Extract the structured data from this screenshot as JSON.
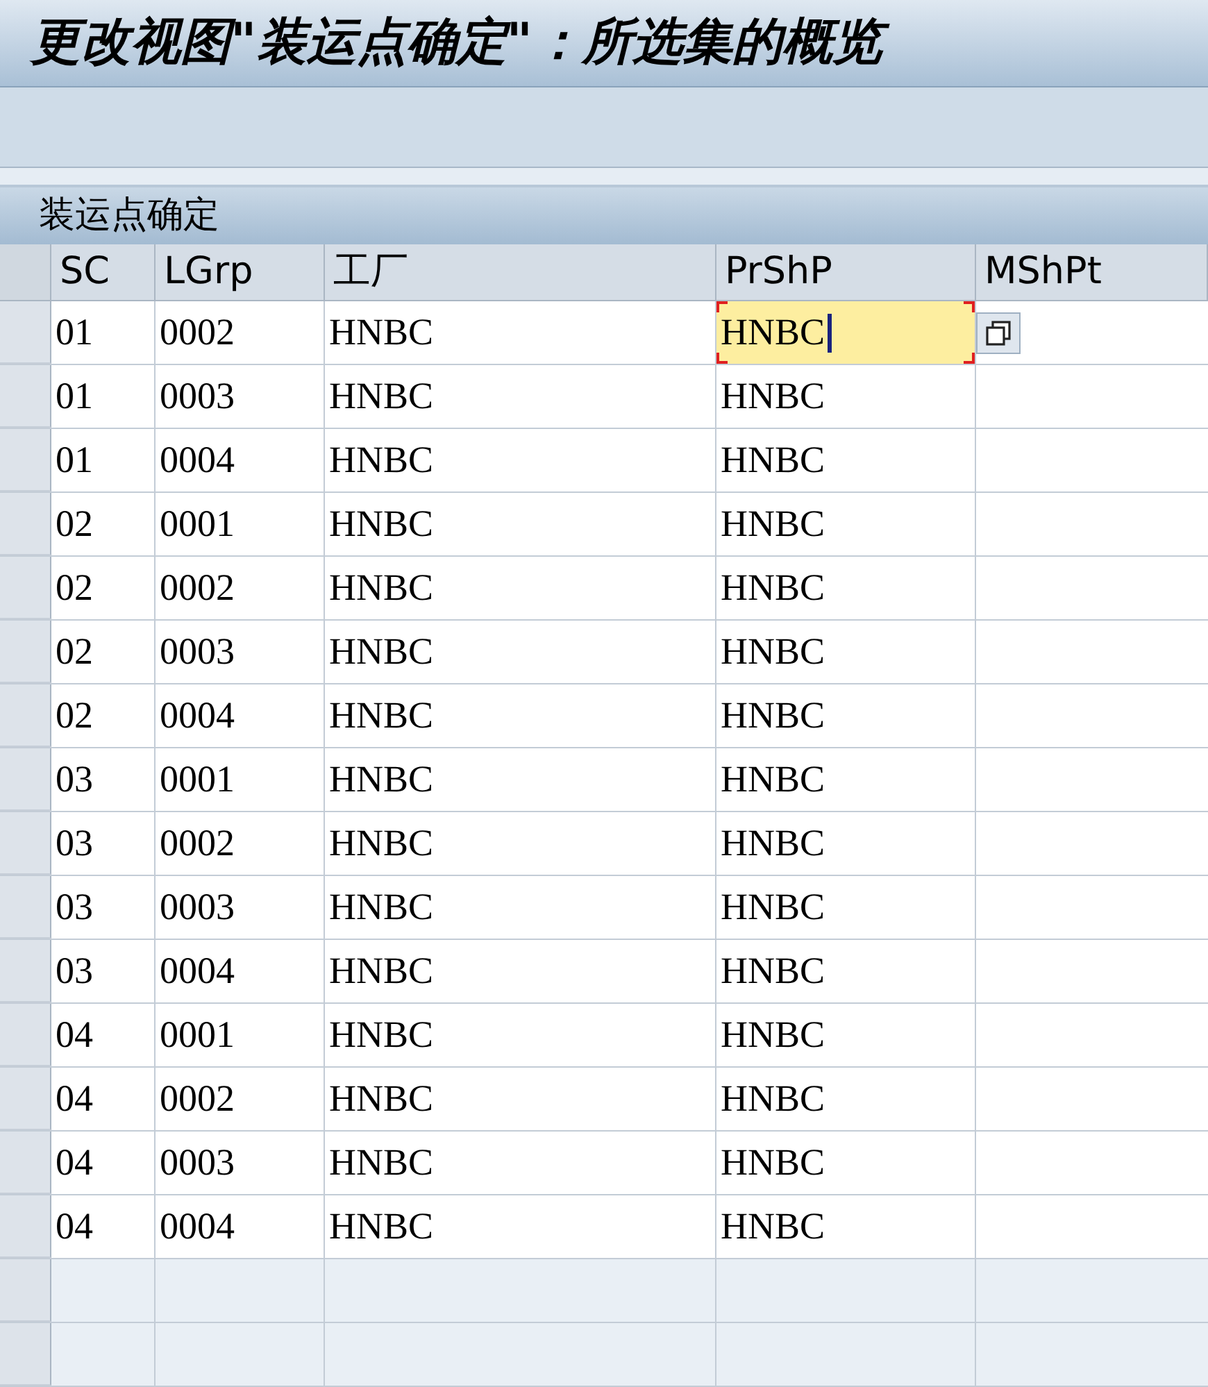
{
  "window": {
    "title": "更改视图\"装运点确定\"：所选集的概览"
  },
  "table": {
    "title": "装运点确定",
    "columns": [
      "SC",
      "LGrp",
      "工厂",
      "PrShP",
      "MShPt"
    ],
    "rows": [
      {
        "sc": "01",
        "lgrp": "0002",
        "plant": "HNBC",
        "prshp": "HNBC",
        "focused": true
      },
      {
        "sc": "01",
        "lgrp": "0003",
        "plant": "HNBC",
        "prshp": "HNBC",
        "focused": false
      },
      {
        "sc": "01",
        "lgrp": "0004",
        "plant": "HNBC",
        "prshp": "HNBC",
        "focused": false
      },
      {
        "sc": "02",
        "lgrp": "0001",
        "plant": "HNBC",
        "prshp": "HNBC",
        "focused": false
      },
      {
        "sc": "02",
        "lgrp": "0002",
        "plant": "HNBC",
        "prshp": "HNBC",
        "focused": false
      },
      {
        "sc": "02",
        "lgrp": "0003",
        "plant": "HNBC",
        "prshp": "HNBC",
        "focused": false
      },
      {
        "sc": "02",
        "lgrp": "0004",
        "plant": "HNBC",
        "prshp": "HNBC",
        "focused": false
      },
      {
        "sc": "03",
        "lgrp": "0001",
        "plant": "HNBC",
        "prshp": "HNBC",
        "focused": false
      },
      {
        "sc": "03",
        "lgrp": "0002",
        "plant": "HNBC",
        "prshp": "HNBC",
        "focused": false
      },
      {
        "sc": "03",
        "lgrp": "0003",
        "plant": "HNBC",
        "prshp": "HNBC",
        "focused": false
      },
      {
        "sc": "03",
        "lgrp": "0004",
        "plant": "HNBC",
        "prshp": "HNBC",
        "focused": false
      },
      {
        "sc": "04",
        "lgrp": "0001",
        "plant": "HNBC",
        "prshp": "HNBC",
        "focused": false
      },
      {
        "sc": "04",
        "lgrp": "0002",
        "plant": "HNBC",
        "prshp": "HNBC",
        "focused": false
      },
      {
        "sc": "04",
        "lgrp": "0003",
        "plant": "HNBC",
        "prshp": "HNBC",
        "focused": false
      },
      {
        "sc": "04",
        "lgrp": "0004",
        "plant": "HNBC",
        "prshp": "HNBC",
        "focused": false
      }
    ]
  }
}
